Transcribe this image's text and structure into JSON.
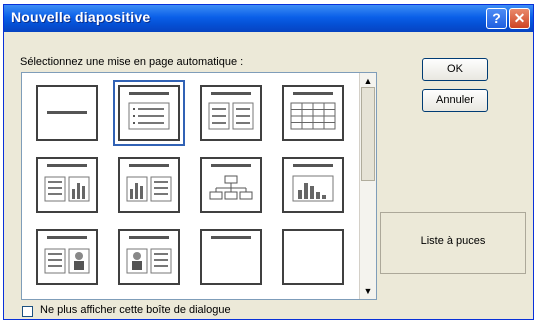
{
  "window": {
    "title": "Nouvelle diapositive"
  },
  "titlebar_buttons": {
    "help": "?",
    "close": "✕"
  },
  "prompt": "Sélectionnez une mise en page automatique :",
  "buttons": {
    "ok": "OK",
    "cancel": "Annuler"
  },
  "preview_label": "Liste à puces",
  "checkbox_label": "Ne plus afficher cette boîte de dialogue",
  "scroll": {
    "up": "▲",
    "down": "▼"
  },
  "colors": {
    "titlebar": "#0a5fe8",
    "selection": "#3162b5",
    "dialog": "#ece9d8"
  },
  "layouts": [
    {
      "kind": "title",
      "selected": false
    },
    {
      "kind": "bulleted-list",
      "selected": true
    },
    {
      "kind": "two-column-text",
      "selected": false
    },
    {
      "kind": "table",
      "selected": false
    },
    {
      "kind": "text-and-chart",
      "selected": false
    },
    {
      "kind": "chart-and-text",
      "selected": false
    },
    {
      "kind": "org-chart",
      "selected": false
    },
    {
      "kind": "chart",
      "selected": false
    },
    {
      "kind": "text-and-clip-art",
      "selected": false
    },
    {
      "kind": "clip-art-and-text",
      "selected": false
    },
    {
      "kind": "title-only",
      "selected": false
    },
    {
      "kind": "blank",
      "selected": false
    }
  ]
}
